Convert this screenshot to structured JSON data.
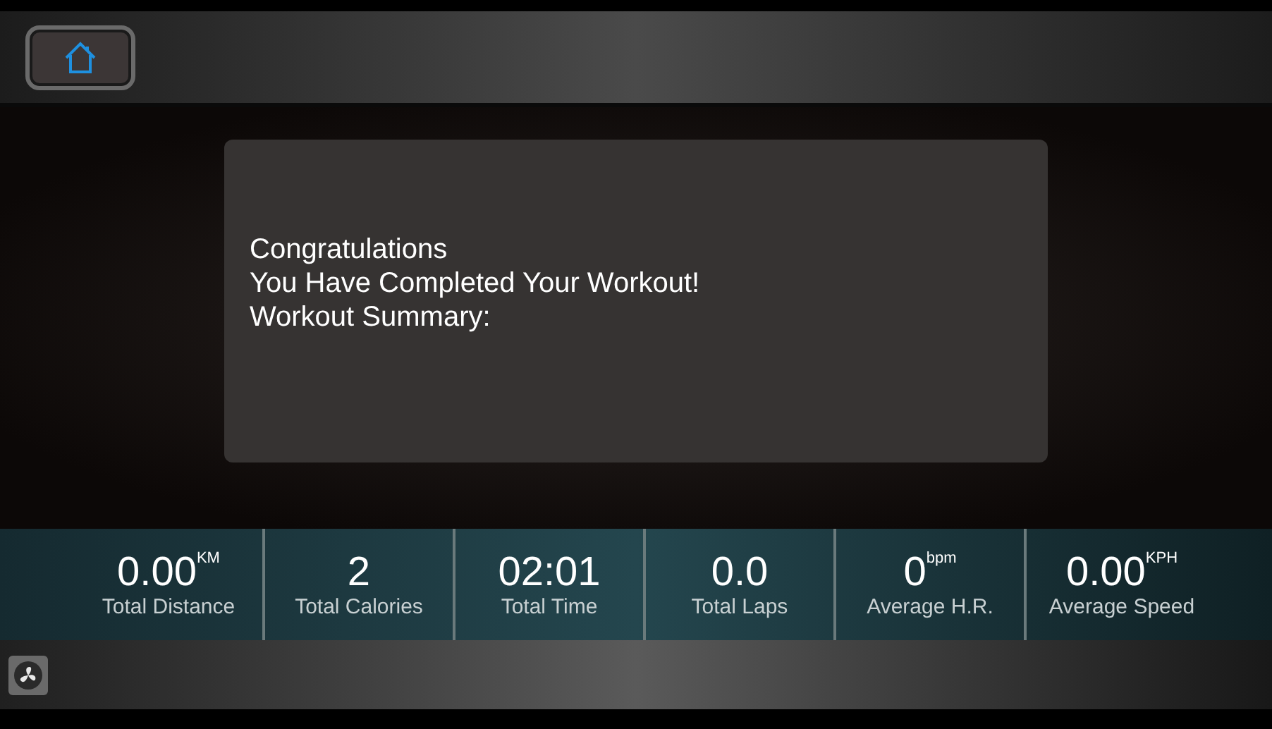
{
  "message": {
    "lines": [
      "Congratulations",
      "You Have Completed Your Workout!",
      "Workout Summary:"
    ]
  },
  "stats": [
    {
      "value": "0.00",
      "unit": "KM",
      "label": "Total Distance"
    },
    {
      "value": "2",
      "label": "Total Calories"
    },
    {
      "value": "02:01",
      "label": "Total Time"
    },
    {
      "value": "0.0",
      "label": "Total Laps"
    },
    {
      "value": "0",
      "unit": "bpm",
      "label": "Average H.R."
    },
    {
      "value": "0.00",
      "unit": "KPH",
      "label": "Average Speed"
    }
  ]
}
